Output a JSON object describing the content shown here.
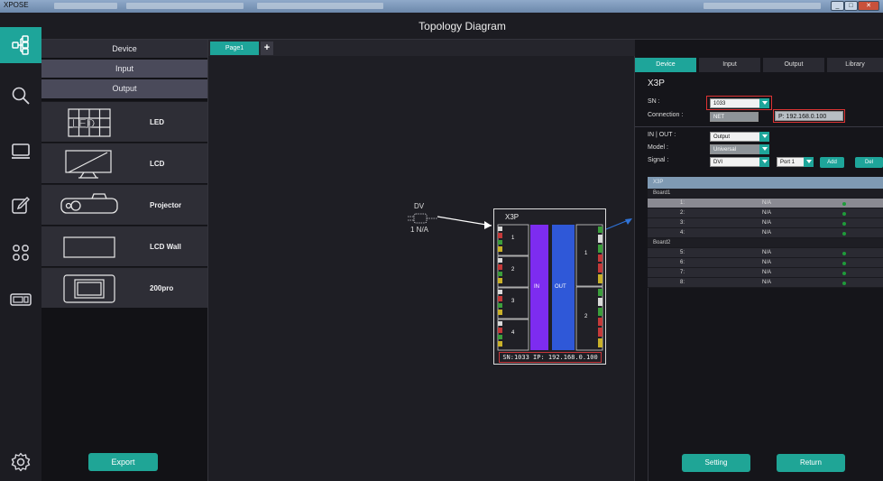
{
  "app": {
    "name": "XPOSE",
    "window_title": "Topology Diagram"
  },
  "colors": {
    "accent": "#1ea59a",
    "in_bar": "#7d2cf0",
    "out_bar": "#2f58d8",
    "status_dot": "#1f9b3a",
    "highlight_border": "#d33333"
  },
  "rail": {
    "items": [
      {
        "name": "topology-icon",
        "active": true
      },
      {
        "name": "search-icon",
        "active": false
      },
      {
        "name": "monitor-icon",
        "active": false
      },
      {
        "name": "edit-icon",
        "active": false
      },
      {
        "name": "grid-icon",
        "active": false
      },
      {
        "name": "device-icon",
        "active": false
      },
      {
        "name": "settings-icon",
        "active": false
      }
    ]
  },
  "left_panel": {
    "device_label": "Device",
    "input_label": "Input",
    "output_label": "Output",
    "devices": [
      {
        "label": "LED",
        "icon": "led-icon",
        "icon_text": "LED"
      },
      {
        "label": "LCD",
        "icon": "lcd-icon"
      },
      {
        "label": "Projector",
        "icon": "projector-icon"
      },
      {
        "label": "LCD Wall",
        "icon": "lcd-wall-icon"
      },
      {
        "label": "200pro",
        "icon": "200pro-icon"
      }
    ],
    "export_label": "Export"
  },
  "canvas": {
    "tab_label": "Page1",
    "add_tab_label": "+",
    "source": {
      "top_label": "DV",
      "bottom_label": "1 N/A"
    },
    "node": {
      "title": "X3P",
      "in_label": "IN",
      "out_label": "OUT",
      "in_ports": [
        "1",
        "2",
        "3",
        "4"
      ],
      "out_ports": [
        "1",
        "2"
      ],
      "footer": "SN:1033 IP: 192.168.0.100"
    }
  },
  "right_panel": {
    "tabs": [
      "Device",
      "Input",
      "Output",
      "Library"
    ],
    "active_tab": "Device",
    "device_name": "X3P",
    "sn_label": "SN :",
    "sn_value": "1033",
    "connection_label": "Connection :",
    "connection_value": "NET",
    "ip_value": "P: 192.168.0.100",
    "in_out_label": "IN | OUT :",
    "in_out_value": "Output",
    "model_label": "Model :",
    "model_value": "Universal",
    "signal_label": "Signal :",
    "signal_value": "DVI",
    "port_value": "Port 1",
    "add_label": "Add",
    "del_label": "Del",
    "table": {
      "header": "X3P",
      "groups": [
        {
          "name": "Board1",
          "rows": [
            {
              "port": "1:",
              "value": "N/A",
              "selected": true
            },
            {
              "port": "2:",
              "value": "N/A",
              "selected": false
            },
            {
              "port": "3:",
              "value": "N/A",
              "selected": false
            },
            {
              "port": "4:",
              "value": "N/A",
              "selected": false
            }
          ]
        },
        {
          "name": "Board2",
          "rows": [
            {
              "port": "5:",
              "value": "N/A",
              "selected": false
            },
            {
              "port": "6:",
              "value": "N/A",
              "selected": false
            },
            {
              "port": "7:",
              "value": "N/A",
              "selected": false
            },
            {
              "port": "8:",
              "value": "N/A",
              "selected": false
            }
          ]
        }
      ]
    },
    "setting_label": "Setting",
    "return_label": "Return"
  }
}
